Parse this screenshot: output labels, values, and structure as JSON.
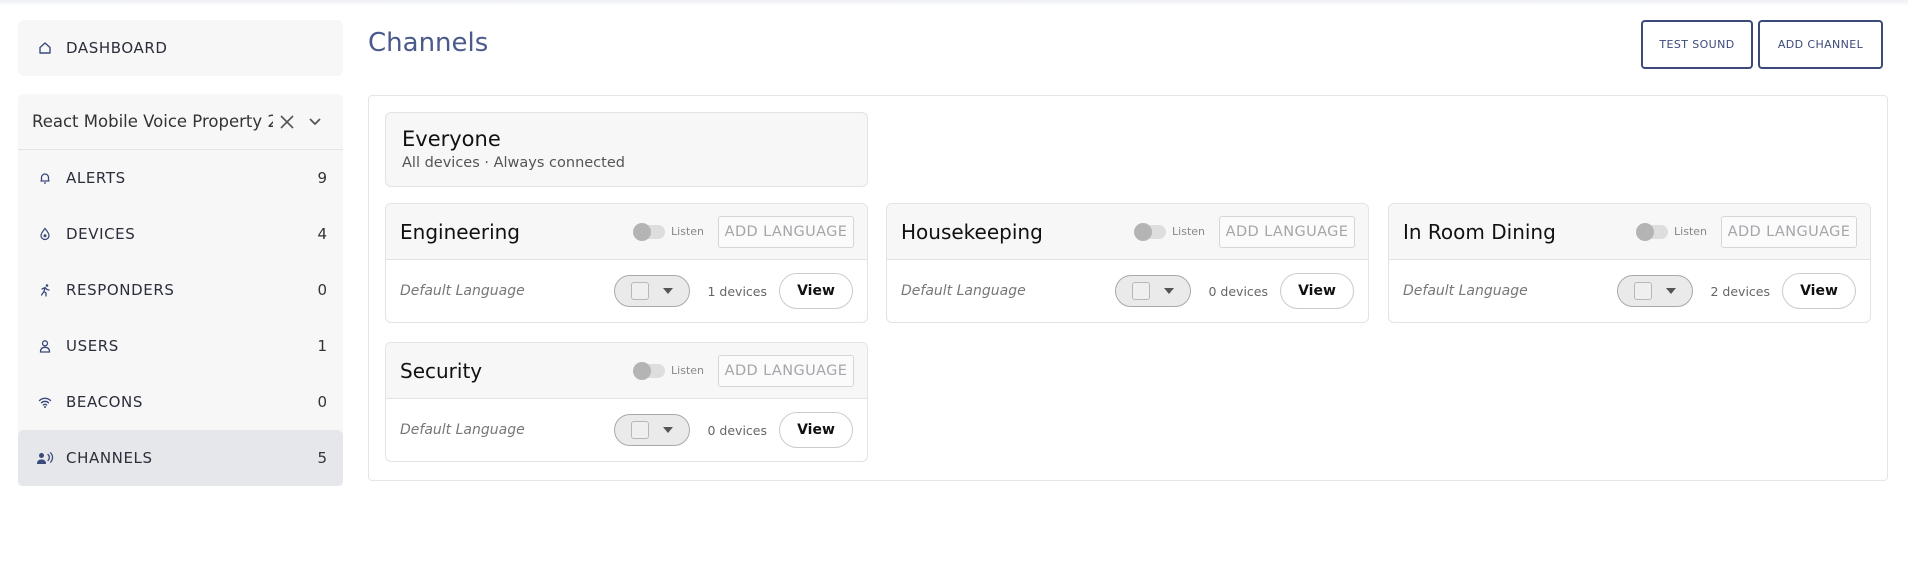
{
  "sidebar": {
    "dashboard_label": "DASHBOARD",
    "property_name": "React Mobile Voice Property 2",
    "items": [
      {
        "label": "ALERTS",
        "count": "9",
        "icon": "bell-icon"
      },
      {
        "label": "DEVICES",
        "count": "4",
        "icon": "device-icon"
      },
      {
        "label": "RESPONDERS",
        "count": "0",
        "icon": "runner-icon"
      },
      {
        "label": "USERS",
        "count": "1",
        "icon": "user-icon"
      },
      {
        "label": "BEACONS",
        "count": "0",
        "icon": "wifi-icon"
      },
      {
        "label": "CHANNELS",
        "count": "5",
        "icon": "channel-icon"
      }
    ]
  },
  "main": {
    "title": "Channels",
    "test_sound_label": "TEST SOUND",
    "add_channel_label": "ADD CHANNEL",
    "everyone": {
      "name": "Everyone",
      "subtitle": "All devices · Always connected"
    },
    "channel_common": {
      "listen_label": "Listen",
      "add_language_label": "ADD LANGUAGE",
      "default_language_label": "Default Language",
      "view_label": "View"
    },
    "channels": [
      {
        "name": "Engineering",
        "devices": "1 devices"
      },
      {
        "name": "Housekeeping",
        "devices": "0 devices"
      },
      {
        "name": "In Room Dining",
        "devices": "2 devices"
      },
      {
        "name": "Security",
        "devices": "0 devices"
      }
    ]
  },
  "colors": {
    "accent": "#3b4a7a",
    "title": "#4a5a8c",
    "active_nav": "#e6e7ea"
  }
}
